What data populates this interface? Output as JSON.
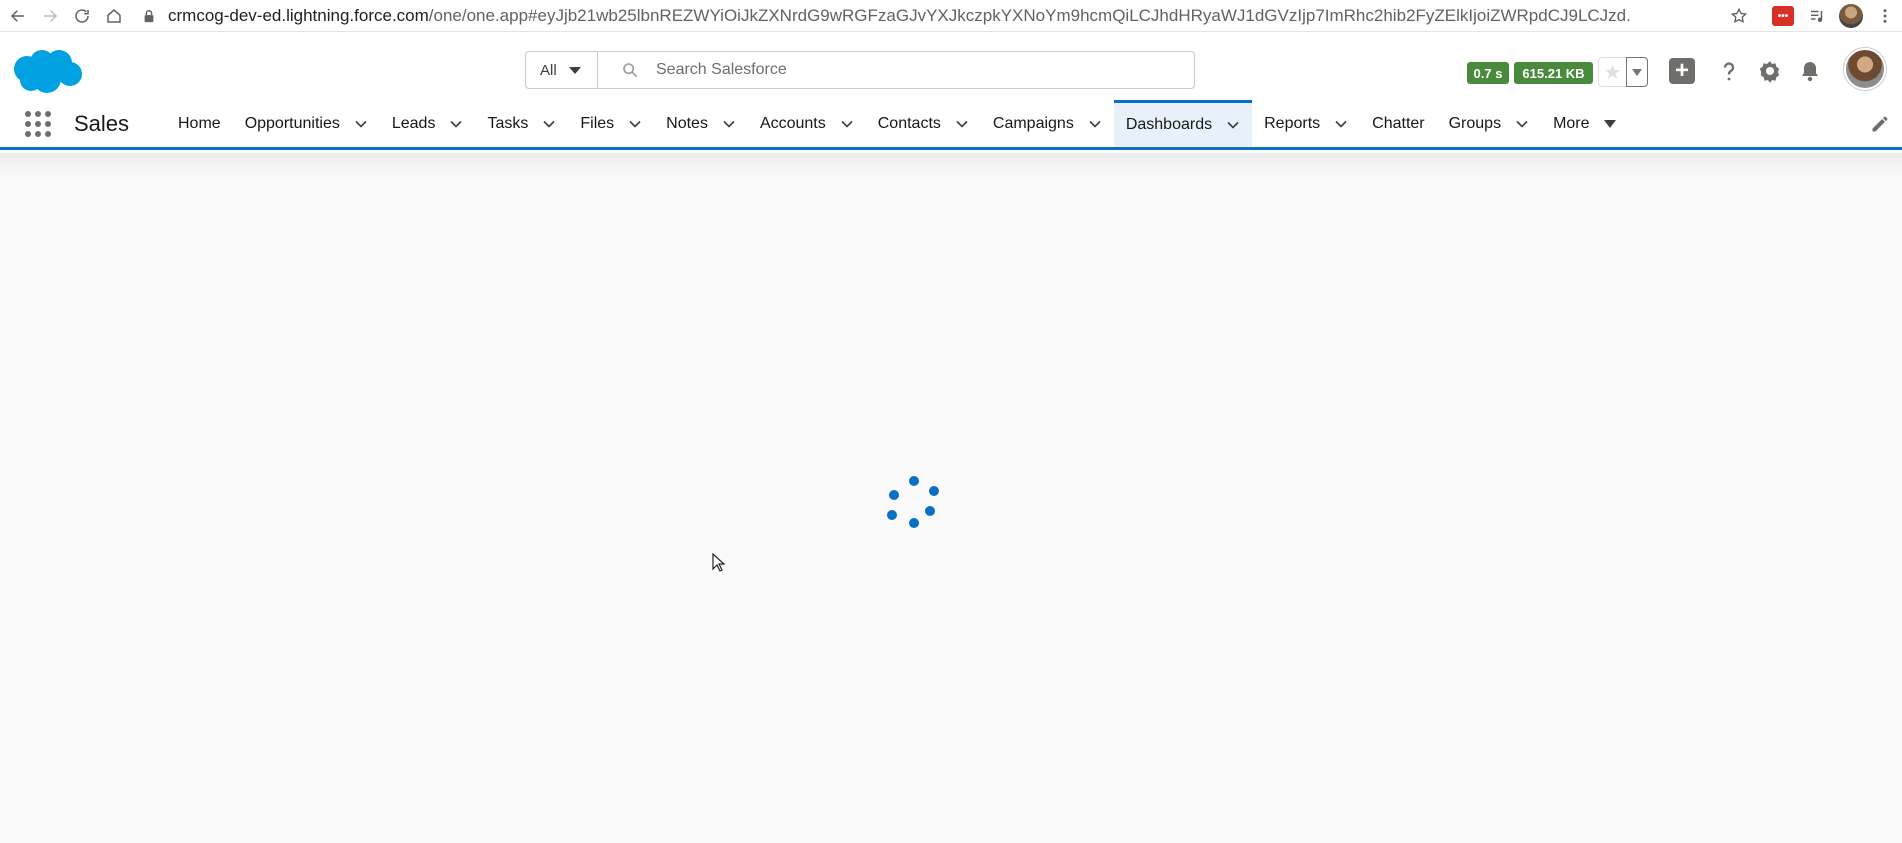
{
  "browser": {
    "url_host": "crmcog-dev-ed.lightning.force.com",
    "url_path": "/one/one.app#eyJjb21wb25lbnREZWYiOiJkZXNrdG9wRGFzaGJvYXJkczpkYXNoYm9hcmQiLCJhdHRyaWJ1dGVzIjp7ImRhc2hib2FyZElkIjoiZWRpdCJ9LCJzd...",
    "ext_label": "•••"
  },
  "search": {
    "scope": "All",
    "placeholder": "Search Salesforce"
  },
  "perf": {
    "time": "0.7 s",
    "size": "615.21 KB"
  },
  "app": {
    "name": "Sales"
  },
  "nav": {
    "items": [
      {
        "label": "Home",
        "dropdown": false
      },
      {
        "label": "Opportunities",
        "dropdown": true
      },
      {
        "label": "Leads",
        "dropdown": true
      },
      {
        "label": "Tasks",
        "dropdown": true
      },
      {
        "label": "Files",
        "dropdown": true
      },
      {
        "label": "Notes",
        "dropdown": true
      },
      {
        "label": "Accounts",
        "dropdown": true
      },
      {
        "label": "Contacts",
        "dropdown": true
      },
      {
        "label": "Campaigns",
        "dropdown": true
      },
      {
        "label": "Dashboards",
        "dropdown": true,
        "active": true
      },
      {
        "label": "Reports",
        "dropdown": true
      },
      {
        "label": "Chatter",
        "dropdown": false
      },
      {
        "label": "Groups",
        "dropdown": true
      }
    ],
    "more_label": "More"
  },
  "colors": {
    "brand_blue": "#0b6fc7",
    "perf_green": "#4a8a3d",
    "cloud_blue": "#00a1e0"
  },
  "icons": {
    "spinner": "loading-spinner-icon",
    "cursor": "mouse-cursor-icon"
  }
}
